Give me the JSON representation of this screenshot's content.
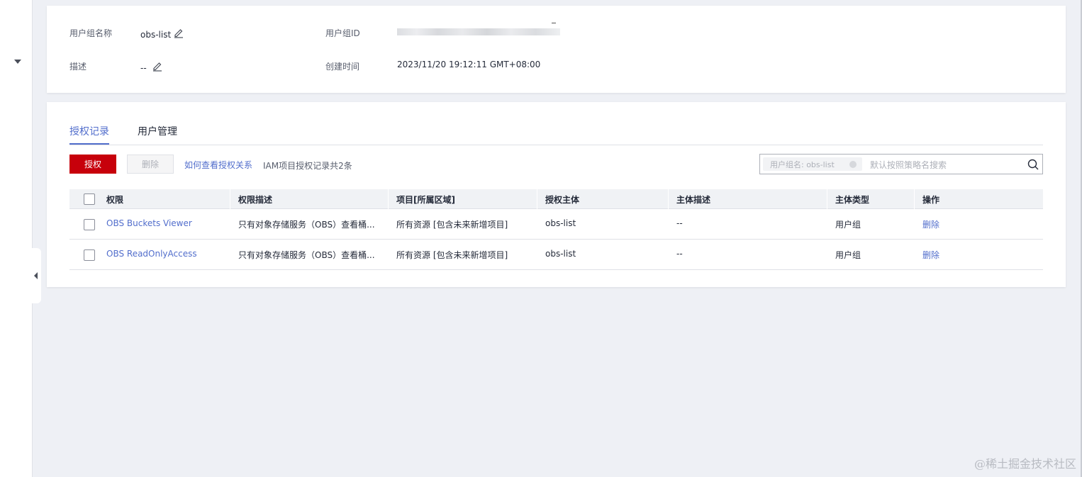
{
  "info": {
    "group_name_label": "用户组名称",
    "group_name_value": "obs-list",
    "group_id_label": "用户组ID",
    "group_id_value": "",
    "description_label": "描述",
    "description_value": "--",
    "created_label": "创建时间",
    "created_value": "2023/11/20 19:12:11 GMT+08:00"
  },
  "tabs": [
    {
      "label": "授权记录",
      "active": true
    },
    {
      "label": "用户管理",
      "active": false
    }
  ],
  "toolbar": {
    "grant_label": "授权",
    "delete_label": "删除",
    "how_link": "如何查看授权关系",
    "record_count": "IAM项目授权记录共2条"
  },
  "search": {
    "chip_text": "用户组名: obs-list",
    "placeholder": "默认按照策略名搜索"
  },
  "table": {
    "headers": [
      "权限",
      "权限描述",
      "项目[所属区域]",
      "授权主体",
      "主体描述",
      "主体类型",
      "操作"
    ],
    "rows": [
      {
        "policy": "OBS Buckets Viewer",
        "policy_desc": "只有对象存储服务（OBS）查看桶...",
        "project": "所有资源 [包含未来新增项目]",
        "principal": "obs-list",
        "principal_desc": "--",
        "principal_type": "用户组",
        "action": "删除"
      },
      {
        "policy": "OBS ReadOnlyAccess",
        "policy_desc": "只有对象存储服务（OBS）查看桶...",
        "project": "所有资源 [包含未来新增项目]",
        "principal": "obs-list",
        "principal_desc": "--",
        "principal_type": "用户组",
        "action": "删除"
      }
    ]
  },
  "watermark": "@稀土掘金技术社区",
  "colors": {
    "primary_red": "#c7000b",
    "link_blue": "#526ecc",
    "page_bg": "#eef0f5"
  },
  "icons": [
    "edit-icon",
    "search-icon",
    "caret-down-icon",
    "collapse-left-icon"
  ]
}
